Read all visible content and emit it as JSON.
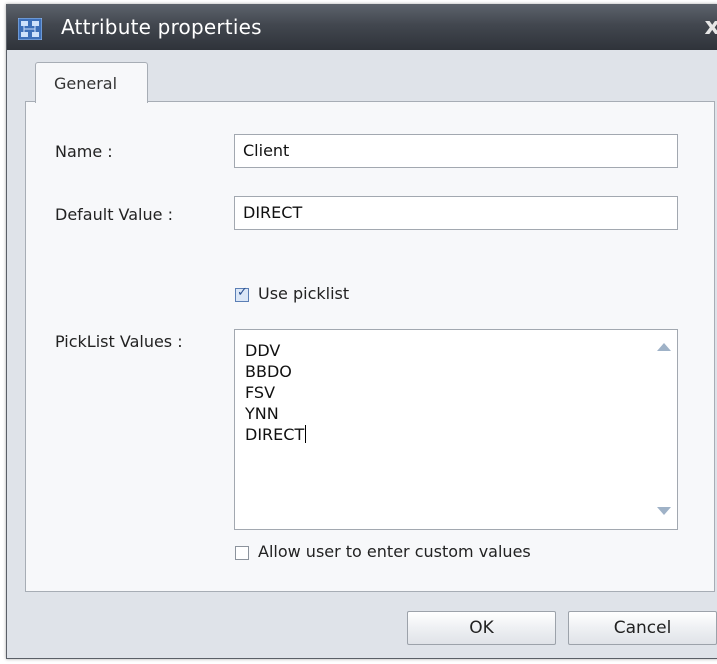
{
  "window": {
    "title": "Attribute properties",
    "close_glyph": "x"
  },
  "tabs": [
    {
      "label": "General",
      "selected": true
    }
  ],
  "form": {
    "name_label": "Name :",
    "name_value": "Client",
    "default_label": "Default Value :",
    "default_value": "DIRECT",
    "use_picklist_label": "Use picklist",
    "use_picklist_checked": true,
    "picklist_label": "PickList Values :",
    "picklist_values": [
      "DDV",
      "BBDO",
      "FSV",
      "YNN",
      "DIRECT"
    ],
    "allow_custom_label": "Allow user to enter custom values",
    "allow_custom_checked": false
  },
  "buttons": {
    "ok": "OK",
    "cancel": "Cancel"
  },
  "colors": {
    "titlebar": "#42474f",
    "dialog_bg": "#dfe3e9",
    "panel_bg": "#f7f8fa"
  },
  "icons": {
    "app": "org-chart-icon",
    "close": "close-icon"
  }
}
